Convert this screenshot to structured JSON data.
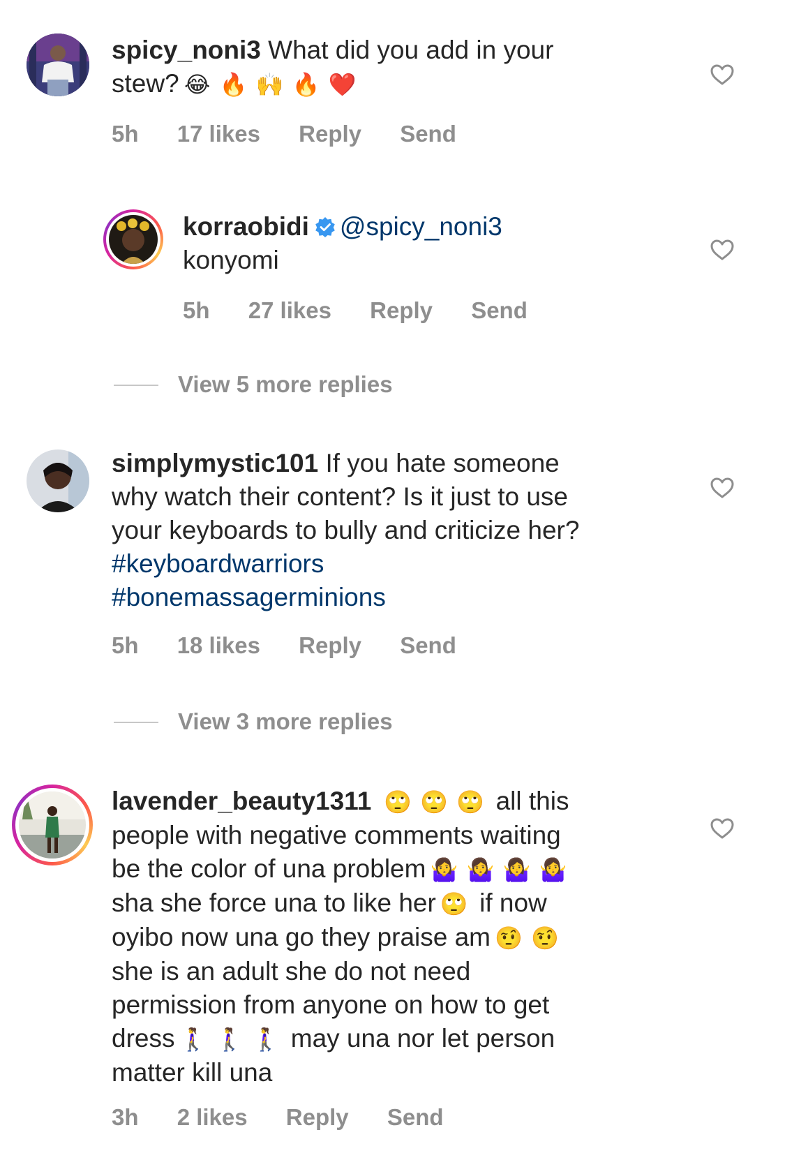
{
  "comments": [
    {
      "username": "spicy_noni3",
      "text": "What did you add in your",
      "text_line2": "stew?",
      "emojis": [
        "😂",
        "🔥",
        "🙌",
        "🔥",
        "❤️"
      ],
      "time": "5h",
      "likes": "17 likes",
      "reply": "Reply",
      "send": "Send"
    },
    {
      "username": "korraobidi",
      "mention": "@spicy_noni3",
      "text": "konyomi",
      "time": "5h",
      "likes": "27 likes",
      "reply": "Reply",
      "send": "Send"
    },
    {
      "username": "simplymystic101",
      "text_line1": "If you hate someone",
      "text_line2": "why watch their content? Is it just to use",
      "text_line3": "your keyboards to bully and criticize her?",
      "hashtag1": "#keyboardwarriors",
      "hashtag2": "#bonemassagerminions",
      "time": "5h",
      "likes": "18 likes",
      "reply": "Reply",
      "send": "Send"
    },
    {
      "username": "lavender_beauty1311",
      "line1_emojis": [
        "🙄",
        "🙄",
        "🙄"
      ],
      "line1_text": "all this",
      "line2": "people with negative comments waiting",
      "line3_text": "be the color of una problem",
      "line3_emojis": [
        "🤷‍♀️",
        "🤷‍♀️",
        "🤷‍♀️",
        "🤷‍♀️"
      ],
      "line4_text": "sha she force una to like her",
      "line4_emoji": "🙄",
      "line4_text2": "if now",
      "line5_text": "oyibo now una go they praise am",
      "line5_emojis": [
        "🤨",
        "🤨"
      ],
      "line6": "she is an adult she do not need",
      "line7": "permission from anyone on how to get",
      "line8_text": "dress",
      "line8_emojis": [
        "🚶‍♀️",
        "🚶‍♀️",
        "🚶‍♀️"
      ],
      "line8_text2": "may una nor let person",
      "line9": "matter kill una",
      "time": "3h",
      "likes": "2 likes",
      "reply": "Reply",
      "send": "Send"
    }
  ],
  "view_replies": [
    "View 5 more replies",
    "View 3 more replies"
  ],
  "icons": {
    "heart": "heart-outline-icon",
    "verified": "verified-badge-icon"
  },
  "colors": {
    "username": "#262626",
    "link": "#00376b",
    "meta": "#8e8e8e",
    "verified": "#3897f0"
  }
}
